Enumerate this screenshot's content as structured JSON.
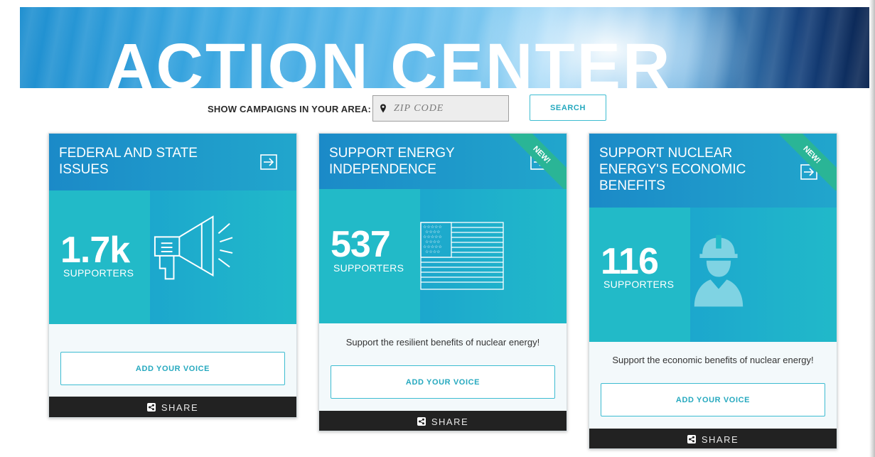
{
  "banner": {
    "title": "ACTION CENTER"
  },
  "search": {
    "label": "SHOW CAMPAIGNS IN YOUR AREA:",
    "placeholder": "ZIP CODE",
    "value": "",
    "button_label": "SEARCH"
  },
  "cards": [
    {
      "title": "FEDERAL AND STATE ISSUES",
      "count": "1.7k",
      "count_label": "SUPPORTERS",
      "icon": "megaphone-icon",
      "description": "",
      "button_label": "ADD YOUR VOICE",
      "share_label": "SHARE",
      "badge": ""
    },
    {
      "title": "SUPPORT ENERGY INDEPENDENCE",
      "count": "537",
      "count_label": "SUPPORTERS",
      "icon": "us-flag-icon",
      "description": "Support the resilient benefits of nuclear energy!",
      "button_label": "ADD YOUR VOICE",
      "share_label": "SHARE",
      "badge": "NEW!"
    },
    {
      "title": "SUPPORT NUCLEAR ENERGY'S ECONOMIC BENEFITS",
      "count": "116",
      "count_label": "SUPPORTERS",
      "icon": "hard-hat-worker-icon",
      "description": "Support the economic benefits of nuclear energy!",
      "button_label": "ADD YOUR VOICE",
      "share_label": "SHARE",
      "badge": "NEW!"
    }
  ],
  "colors": {
    "accent": "#26a9bf",
    "card_header": "#1b8ac8",
    "stats_bg": "#22bac8",
    "badge": "#2ab596",
    "share_bar": "#222222"
  }
}
